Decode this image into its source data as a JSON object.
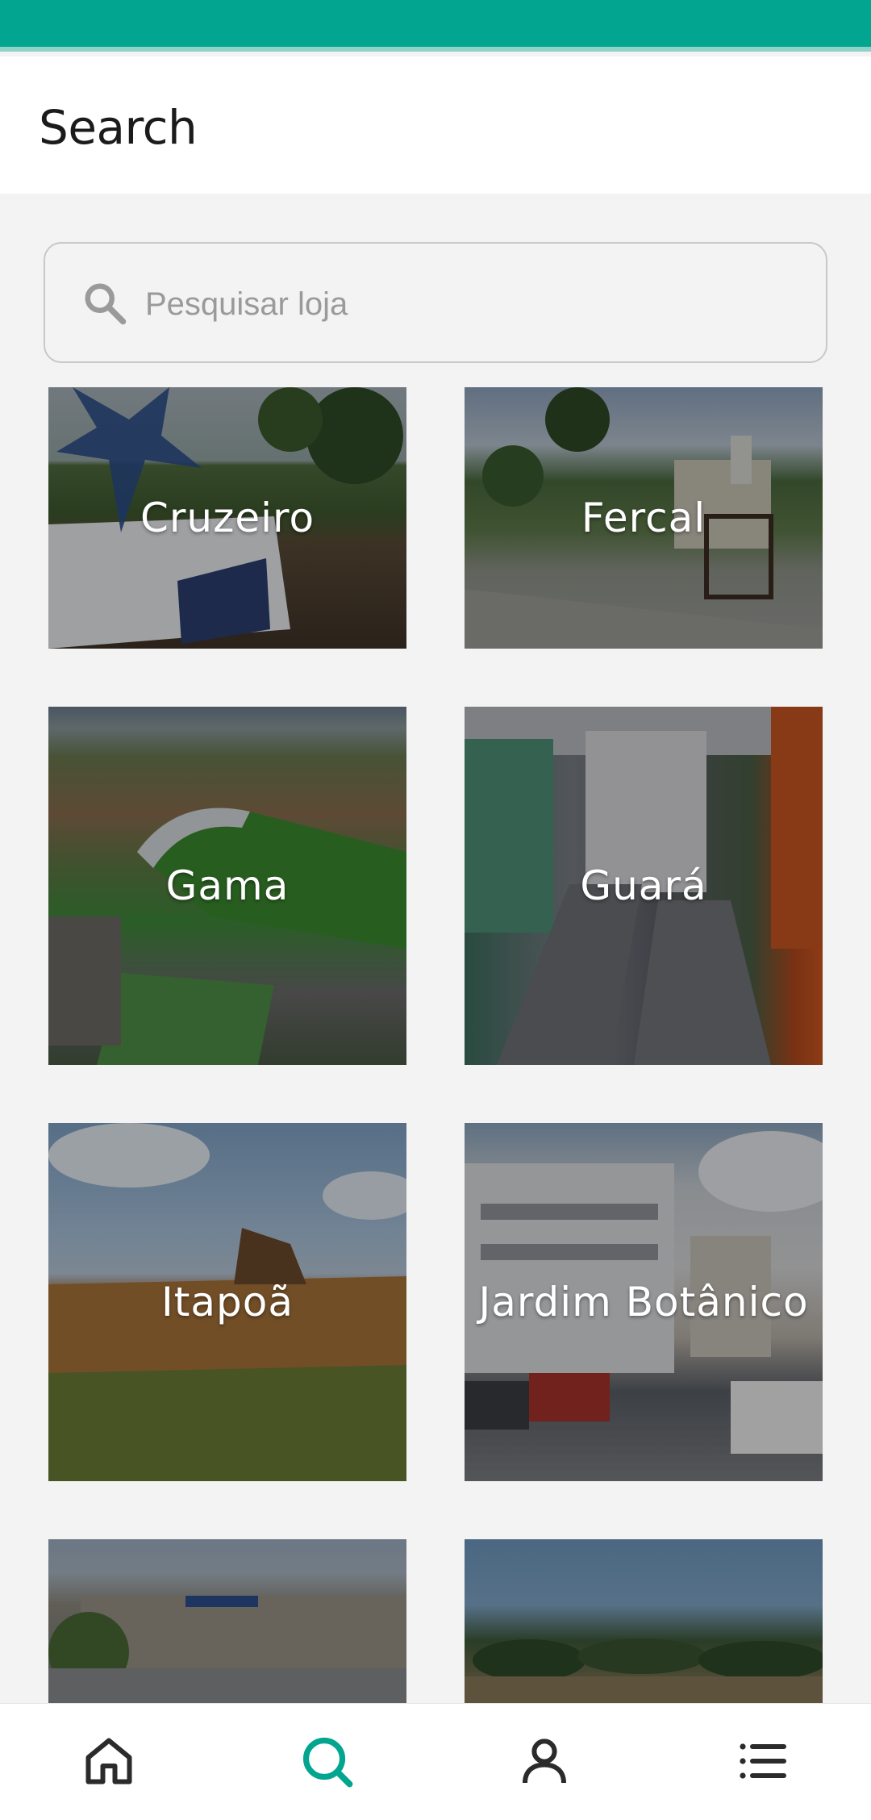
{
  "header": {
    "title": "Search"
  },
  "search": {
    "placeholder": "Pesquisar loja"
  },
  "regions": [
    {
      "name": "Cruzeiro"
    },
    {
      "name": "Fercal"
    },
    {
      "name": "Gama"
    },
    {
      "name": "Guará"
    },
    {
      "name": "Itapoã"
    },
    {
      "name": "Jardim Botânico"
    },
    {
      "name": ""
    },
    {
      "name": ""
    }
  ],
  "bottom_nav": [
    {
      "icon": "home-icon",
      "active": false
    },
    {
      "icon": "search-icon",
      "active": true
    },
    {
      "icon": "profile-icon",
      "active": false
    },
    {
      "icon": "list-icon",
      "active": false
    }
  ],
  "colors": {
    "accent": "#02a58f",
    "icon_inactive": "#2b2b2b"
  }
}
